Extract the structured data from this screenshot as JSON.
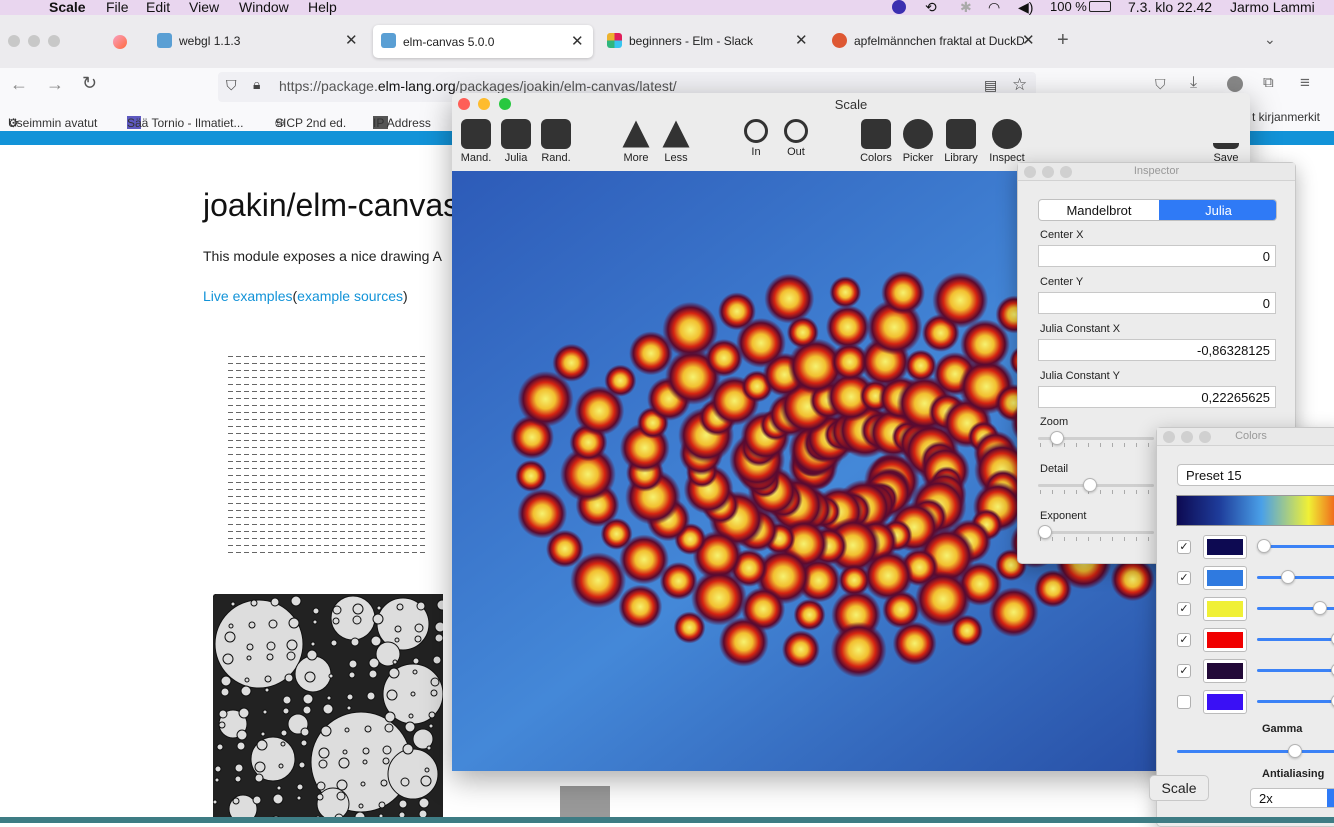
{
  "menubar": {
    "app_name": "Scale",
    "items": [
      "File",
      "Edit",
      "View",
      "Window",
      "Help"
    ],
    "battery": "100 %",
    "datetime": "7.3. klo  22.42",
    "user": "Jarmo Lammi"
  },
  "tabs": [
    {
      "label": "webgl 1.1.3"
    },
    {
      "label": "elm-canvas 5.0.0"
    },
    {
      "label": "beginners - Elm - Slack"
    },
    {
      "label": "apfelmännchen fraktal at DuckD"
    }
  ],
  "address": {
    "prefix": "https://package.",
    "domain": "elm-lang.org",
    "path": "/packages/joakin/elm-canvas/latest/"
  },
  "bookmarks": [
    "Useimmin avatut",
    "Sää Tornio - Ilmatiet...",
    "SICP 2nd ed.",
    "IP Address",
    "t kirjanmerkit"
  ],
  "page": {
    "title": "joakin/elm-canvas",
    "intro": "This module exposes a nice drawing A",
    "link_examples": "Live examples",
    "link_sources": "example sources",
    "paren_open": "(",
    "paren_close": ")"
  },
  "scale_window": {
    "title": "Scale",
    "toolbar": [
      {
        "label": "Mand.",
        "icon": "mandelbrot-icon"
      },
      {
        "label": "Julia",
        "icon": "julia-icon"
      },
      {
        "label": "Rand.",
        "icon": "shuffle-icon"
      },
      {
        "label": "More",
        "icon": "more-triangle-icon"
      },
      {
        "label": "Less",
        "icon": "less-triangle-icon"
      },
      {
        "label": "In",
        "icon": "zoom-in-icon"
      },
      {
        "label": "Out",
        "icon": "zoom-out-icon"
      },
      {
        "label": "Colors",
        "icon": "palette-icon"
      },
      {
        "label": "Picker",
        "icon": "compass-icon"
      },
      {
        "label": "Library",
        "icon": "folder-icon"
      },
      {
        "label": "Inspect",
        "icon": "gear-icon"
      },
      {
        "label": "Save",
        "icon": "download-icon"
      }
    ]
  },
  "inspector": {
    "title": "Inspector",
    "seg_mandelbrot": "Mandelbrot",
    "seg_julia": "Julia",
    "center_x_label": "Center X",
    "center_x": "0",
    "center_y_label": "Center Y",
    "center_y": "0",
    "julia_x_label": "Julia Constant X",
    "julia_x": "-0,86328125",
    "julia_y_label": "Julia Constant Y",
    "julia_y": "0,22265625",
    "zoom_label": "Zoom",
    "detail_label": "Detail",
    "exponent_label": "Exponent"
  },
  "colors_panel": {
    "title": "Colors",
    "preset": "Preset 15",
    "stops": [
      {
        "color": "#0d0a52",
        "checked": true,
        "level": 0.0
      },
      {
        "color": "#2f7ae0",
        "checked": true,
        "level": 0.33
      },
      {
        "color": "#f0f035",
        "checked": true,
        "level": 0.75
      },
      {
        "color": "#f00000",
        "checked": true,
        "level": 1.0
      },
      {
        "color": "#220938",
        "checked": true,
        "level": 1.0
      },
      {
        "color": "#3a10f5",
        "checked": false,
        "level": 1.0
      }
    ],
    "gamma_label": "Gamma",
    "antialiasing_label": "Antialiasing",
    "antialiasing_value": "2x",
    "checkmark": "✓"
  },
  "dock_tooltip": "Scale"
}
